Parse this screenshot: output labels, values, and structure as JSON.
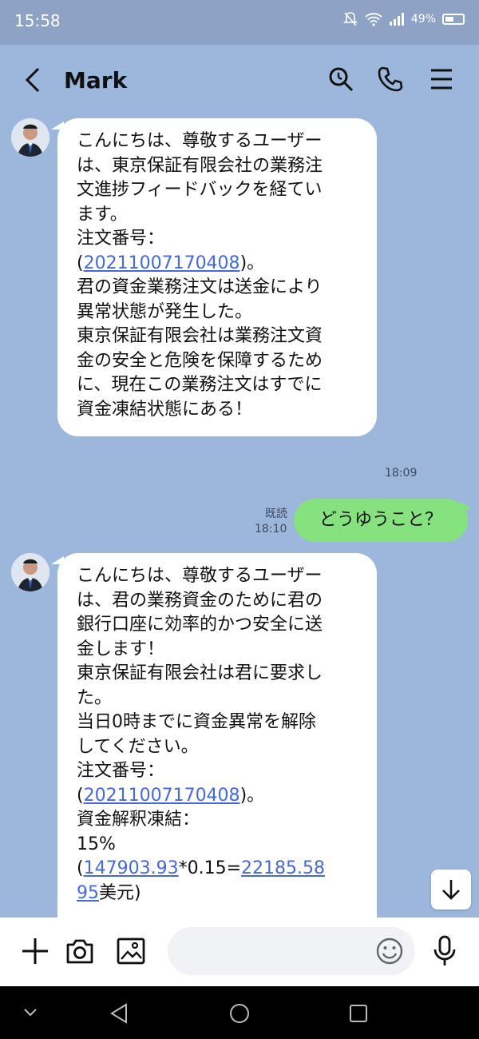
{
  "status_bar": {
    "time": "15:58",
    "battery": "49%"
  },
  "header": {
    "title": "Mark"
  },
  "messages": {
    "received_1": {
      "lines": [
        "こんにちは、尊敬するユーザー",
        "は、東京保証有限会社の業務注",
        "文進捗フィードバックを経てい",
        "ます。",
        "注文番号：",
        "",
        "君の資金業務注文は送金により",
        "異常状態が発生した。",
        "東京保証有限会社は業務注文資",
        "金の安全と危険を保障するため",
        "に、現在この業務注文はすでに",
        "資金凍結状態にある！"
      ],
      "order_prefix": "(",
      "order_number": "20211007170408",
      "order_suffix": ")。",
      "time": "18:09"
    },
    "sent_1": {
      "text": "どうゆうこと？",
      "read": "既読",
      "time": "18:10"
    },
    "received_2": {
      "lines": [
        "こんにちは、尊敬するユーザー",
        "は、君の業務資金のために君の",
        "銀行口座に効率的かつ安全に送",
        "金します！",
        "東京保証有限会社は君に要求し",
        "た。",
        "当日0時までに資金異常を解除",
        "してください。",
        "注文番号：",
        "",
        "資金解釈凍結："
      ],
      "order_prefix": "(",
      "order_number": "20211007170408",
      "order_suffix": ")。",
      "calc_prefix": "15%(",
      "calc_amount": "147903.93",
      "calc_mid": "*0.15=",
      "calc_result": "22185.58",
      "calc_cont": "95",
      "calc_tail": "美元)"
    }
  },
  "input": {
    "placeholder": ""
  },
  "icons": {
    "back": "chevron-left-icon",
    "search": "search-icon",
    "call": "phone-icon",
    "menu": "menu-icon",
    "plus": "plus-icon",
    "camera": "camera-icon",
    "image": "image-icon",
    "emoji": "smiley-icon",
    "mic": "microphone-icon",
    "scroll": "arrow-down-icon"
  },
  "colors": {
    "background": "#9db6db",
    "sent_bubble": "#86e27e",
    "link": "#4668d8",
    "header": "#8ea2c5"
  }
}
